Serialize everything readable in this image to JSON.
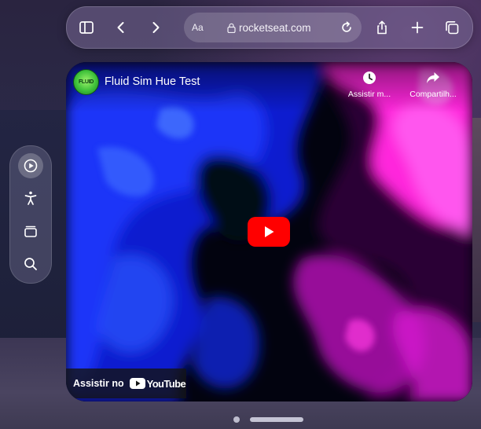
{
  "browser": {
    "aa_label": "Aa",
    "url": "rocketseat.com",
    "icons": [
      "sidebar-icon",
      "back-icon",
      "forward-icon",
      "lock-icon",
      "reload-icon",
      "share-icon",
      "new-tab-icon",
      "tabs-icon"
    ]
  },
  "side_panel": {
    "items": [
      {
        "name": "media-play-icon"
      },
      {
        "name": "accessibility-icon"
      },
      {
        "name": "tab-overview-icon"
      },
      {
        "name": "search-icon"
      }
    ]
  },
  "video": {
    "channel_avatar_text": "FLUID",
    "title": "Fluid Sim Hue Test",
    "watch_later_label": "Assistir m...",
    "share_label": "Compartilh...",
    "watch_on_label": "Assistir no",
    "youtube_label": "YouTube",
    "colors": {
      "play_button": "#ff0000",
      "accent_blue": "#1a2cff",
      "accent_magenta": "#ff2ee0"
    }
  }
}
